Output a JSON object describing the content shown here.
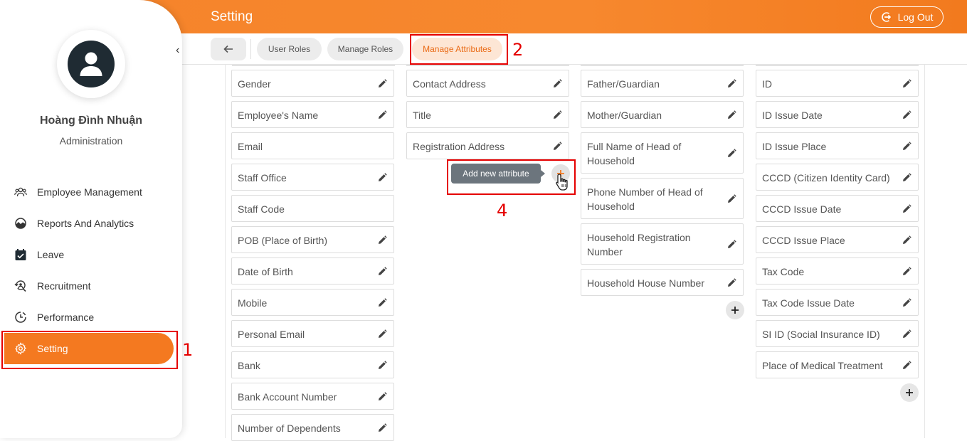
{
  "header": {
    "title": "Setting",
    "logout_label": "Log Out"
  },
  "user": {
    "name": "Hoàng Đình Nhuận",
    "role": "Administration"
  },
  "sidebar": {
    "items": [
      {
        "label": "Employee Management",
        "icon": "users-icon"
      },
      {
        "label": "Reports And Analytics",
        "icon": "chart-circle-icon"
      },
      {
        "label": "Leave",
        "icon": "calendar-check-icon"
      },
      {
        "label": "Recruitment",
        "icon": "recruit-icon"
      },
      {
        "label": "Performance",
        "icon": "clock-chart-icon"
      },
      {
        "label": "Setting",
        "icon": "gear-icon",
        "active": true
      }
    ]
  },
  "tabs": {
    "items": [
      "User Roles",
      "Manage Roles",
      "Manage Attributes"
    ],
    "active": "Manage Attributes"
  },
  "columns": [
    {
      "fields": [
        {
          "label": "Gender",
          "editable": true
        },
        {
          "label": "Employee's Name",
          "editable": true
        },
        {
          "label": "Email",
          "editable": false
        },
        {
          "label": "Staff Office",
          "editable": true
        },
        {
          "label": "Staff Code",
          "editable": false
        },
        {
          "label": "POB (Place of Birth)",
          "editable": true
        },
        {
          "label": "Date of Birth",
          "editable": true
        },
        {
          "label": "Mobile",
          "editable": true
        },
        {
          "label": "Personal Email",
          "editable": true
        },
        {
          "label": "Bank",
          "editable": true
        },
        {
          "label": "Bank Account Number",
          "editable": true
        },
        {
          "label": "Number of Dependents",
          "editable": true
        }
      ]
    },
    {
      "fields": [
        {
          "label": "Contact Address",
          "editable": true
        },
        {
          "label": "Title",
          "editable": true
        },
        {
          "label": "Registration Address",
          "editable": true
        }
      ]
    },
    {
      "fields": [
        {
          "label": "Father/Guardian",
          "editable": true
        },
        {
          "label": "Mother/Guardian",
          "editable": true
        },
        {
          "label": "Full Name of Head of Household",
          "editable": true
        },
        {
          "label": "Phone Number of Head of Household",
          "editable": true
        },
        {
          "label": "Household Registration Number",
          "editable": true
        },
        {
          "label": "Household House Number",
          "editable": true
        }
      ]
    },
    {
      "fields": [
        {
          "label": "ID",
          "editable": true
        },
        {
          "label": "ID Issue Date",
          "editable": true
        },
        {
          "label": "ID Issue Place",
          "editable": true
        },
        {
          "label": "CCCD (Citizen Identity Card)",
          "editable": true
        },
        {
          "label": "CCCD Issue Date",
          "editable": true
        },
        {
          "label": "CCCD Issue Place",
          "editable": true
        },
        {
          "label": "Tax Code",
          "editable": true
        },
        {
          "label": "Tax Code Issue Date",
          "editable": true
        },
        {
          "label": "SI ID (Social Insurance ID)",
          "editable": true
        },
        {
          "label": "Place of Medical Treatment",
          "editable": true
        }
      ]
    }
  ],
  "tooltip": {
    "text": "Add new attribute"
  },
  "annotations": [
    "1",
    "2",
    "4"
  ],
  "colors": {
    "accent": "#f47920",
    "highlight": "#e50000"
  }
}
